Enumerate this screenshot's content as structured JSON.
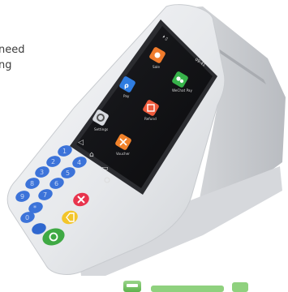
{
  "side_text": {
    "line1": "need",
    "line2": "ng"
  },
  "status_bar": {
    "left": "⏵ ▯",
    "time": "09:41"
  },
  "apps": [
    {
      "label": "Sale",
      "color": "#f07b2c",
      "icon": "sale-app-icon"
    },
    {
      "label": "Pay",
      "color": "#2f7de1",
      "icon": "pay-app-icon"
    },
    {
      "label": "WeChat Pay",
      "color": "#37b24a",
      "icon": "wechat-pay-app-icon"
    },
    {
      "label": "Settings",
      "color": "#d8dbe0",
      "icon": "settings-app-icon"
    },
    {
      "label": "Refund",
      "color": "#ee5a3c",
      "icon": "refund-app-icon"
    },
    {
      "label": "Voucher",
      "color": "#f2822a",
      "icon": "voucher-app-icon"
    }
  ],
  "keypad": {
    "number_keys": [
      "1",
      "2",
      "3",
      "4",
      "5",
      "6",
      "7",
      "8",
      "9",
      "*",
      "0",
      "#"
    ],
    "cancel_color": "#e8344d",
    "clear_color": "#f3c52a",
    "enter_color": "#3fa944",
    "func_color": "#2f73d8"
  },
  "colors": {
    "body": "#e9eaec",
    "screen": "#111215",
    "keypad_key": "#3c73d9",
    "logo": "#7cc46c"
  }
}
